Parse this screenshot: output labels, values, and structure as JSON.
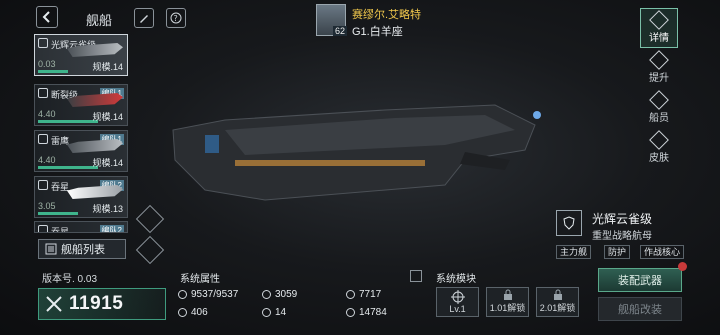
{
  "header": {
    "title": "舰船"
  },
  "commander": {
    "name": "赛缪尔.艾略特",
    "level": "62",
    "fleet": "G1.白羊座"
  },
  "ships": [
    {
      "name": "光辉云雀级",
      "score": "0.03",
      "scale": "规模.14",
      "team": ""
    },
    {
      "name": "断裂级",
      "score": "4.40",
      "scale": "规模.14",
      "team": "编队1"
    },
    {
      "name": "雷鹰",
      "score": "4.40",
      "scale": "规模.14",
      "team": "编队1"
    },
    {
      "name": "吞星",
      "score": "3.05",
      "scale": "规模.13",
      "team": "编队2"
    },
    {
      "name": "吞星",
      "score": "",
      "scale": "",
      "team": "编队2"
    }
  ],
  "fleet_list_label": "舰船列表",
  "nav": [
    {
      "label": "详情"
    },
    {
      "label": "提升"
    },
    {
      "label": "船员"
    },
    {
      "label": "皮肤"
    }
  ],
  "ship_info": {
    "class_name": "光辉云雀级",
    "class_type": "重型战略航母",
    "roles": [
      "主力舰",
      "防护",
      "作战核心"
    ]
  },
  "version": "版本号. 0.03",
  "power": "11915",
  "attributes": {
    "title": "系统属性",
    "values": [
      "9537/9537",
      "3059",
      "7717",
      "406",
      "14",
      "14784"
    ]
  },
  "modules": {
    "title": "系统模块",
    "slots": [
      "Lv.1",
      "1.01解锁",
      "2.01解锁"
    ]
  },
  "buttons": {
    "equip": "装配武器",
    "refit": "舰船改装"
  },
  "colors": {
    "accent": "#3fb48c",
    "commander_name": "#f2c94c",
    "alert": "#c83a3a"
  },
  "icons": {
    "back": "chevron-left-icon",
    "skin": "brush-icon",
    "help": "question-icon",
    "nav": [
      "detail-icon",
      "upgrade-icon",
      "crew-icon",
      "skin-icon"
    ]
  }
}
